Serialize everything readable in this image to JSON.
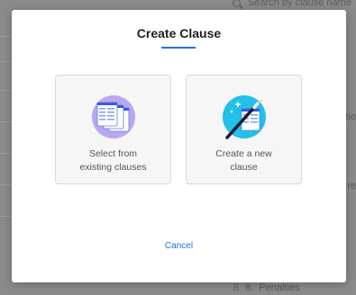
{
  "background": {
    "search_placeholder": "Search by clause name",
    "edge_text_1": "tio",
    "edge_text_2": "re",
    "footer_number": "8.",
    "footer_label": "Penalties"
  },
  "modal": {
    "title": "Create Clause",
    "options": [
      {
        "label_line1": "Select from",
        "label_line2": "existing clauses",
        "icon": "documents-stack-icon"
      },
      {
        "label_line1": "Create a new",
        "label_line2": "clause",
        "icon": "magic-wand-icon"
      }
    ],
    "cancel_label": "Cancel"
  },
  "colors": {
    "accent": "#1a73e8",
    "card_bg": "#f6f6f6",
    "purple_circle": "#b9a8f0",
    "cyan_circle": "#22c1e8"
  }
}
